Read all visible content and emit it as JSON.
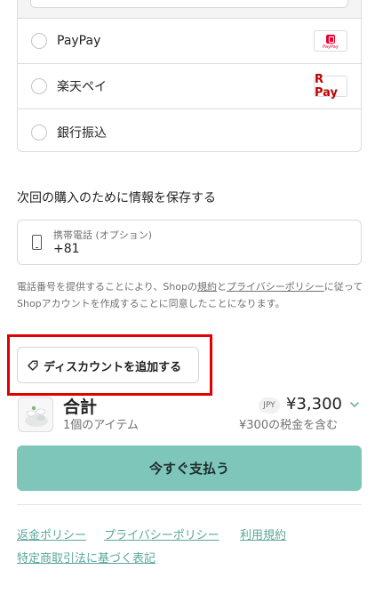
{
  "payment": {
    "options": [
      {
        "label": "PayPay",
        "logo": "paypay-logo",
        "logo_text": "PayPay"
      },
      {
        "label": "楽天ペイ",
        "logo": "rakuten-pay-logo",
        "logo_text": "R Pay"
      },
      {
        "label": "銀行振込"
      }
    ]
  },
  "save_info": {
    "heading": "次回の購入のために情報を保存する",
    "phone_label": "携帯電話 (オプション)",
    "phone_value": "+81"
  },
  "consent": {
    "part1": "電話番号を提供することにより、Shopの",
    "terms_link": "規約",
    "part2": "と",
    "privacy_link": "プライバシーポリシー",
    "part3": "に従ってShopアカウントを作成することに同意したことになります。"
  },
  "discount": {
    "label": "ディスカウントを追加する"
  },
  "summary": {
    "title": "合計",
    "items": "1個のアイテム",
    "currency": "JPY",
    "price": "¥3,300",
    "tax": "¥300の税金を含む"
  },
  "pay_button": {
    "label": "今すぐ支払う"
  },
  "footer": {
    "links": [
      "返金ポリシー",
      "プライバシーポリシー",
      "利用規約",
      "特定商取引法に基づく表記"
    ]
  },
  "colors": {
    "accent": "#7ec6ba",
    "link": "#5aa79a",
    "highlight": "#e00000"
  }
}
